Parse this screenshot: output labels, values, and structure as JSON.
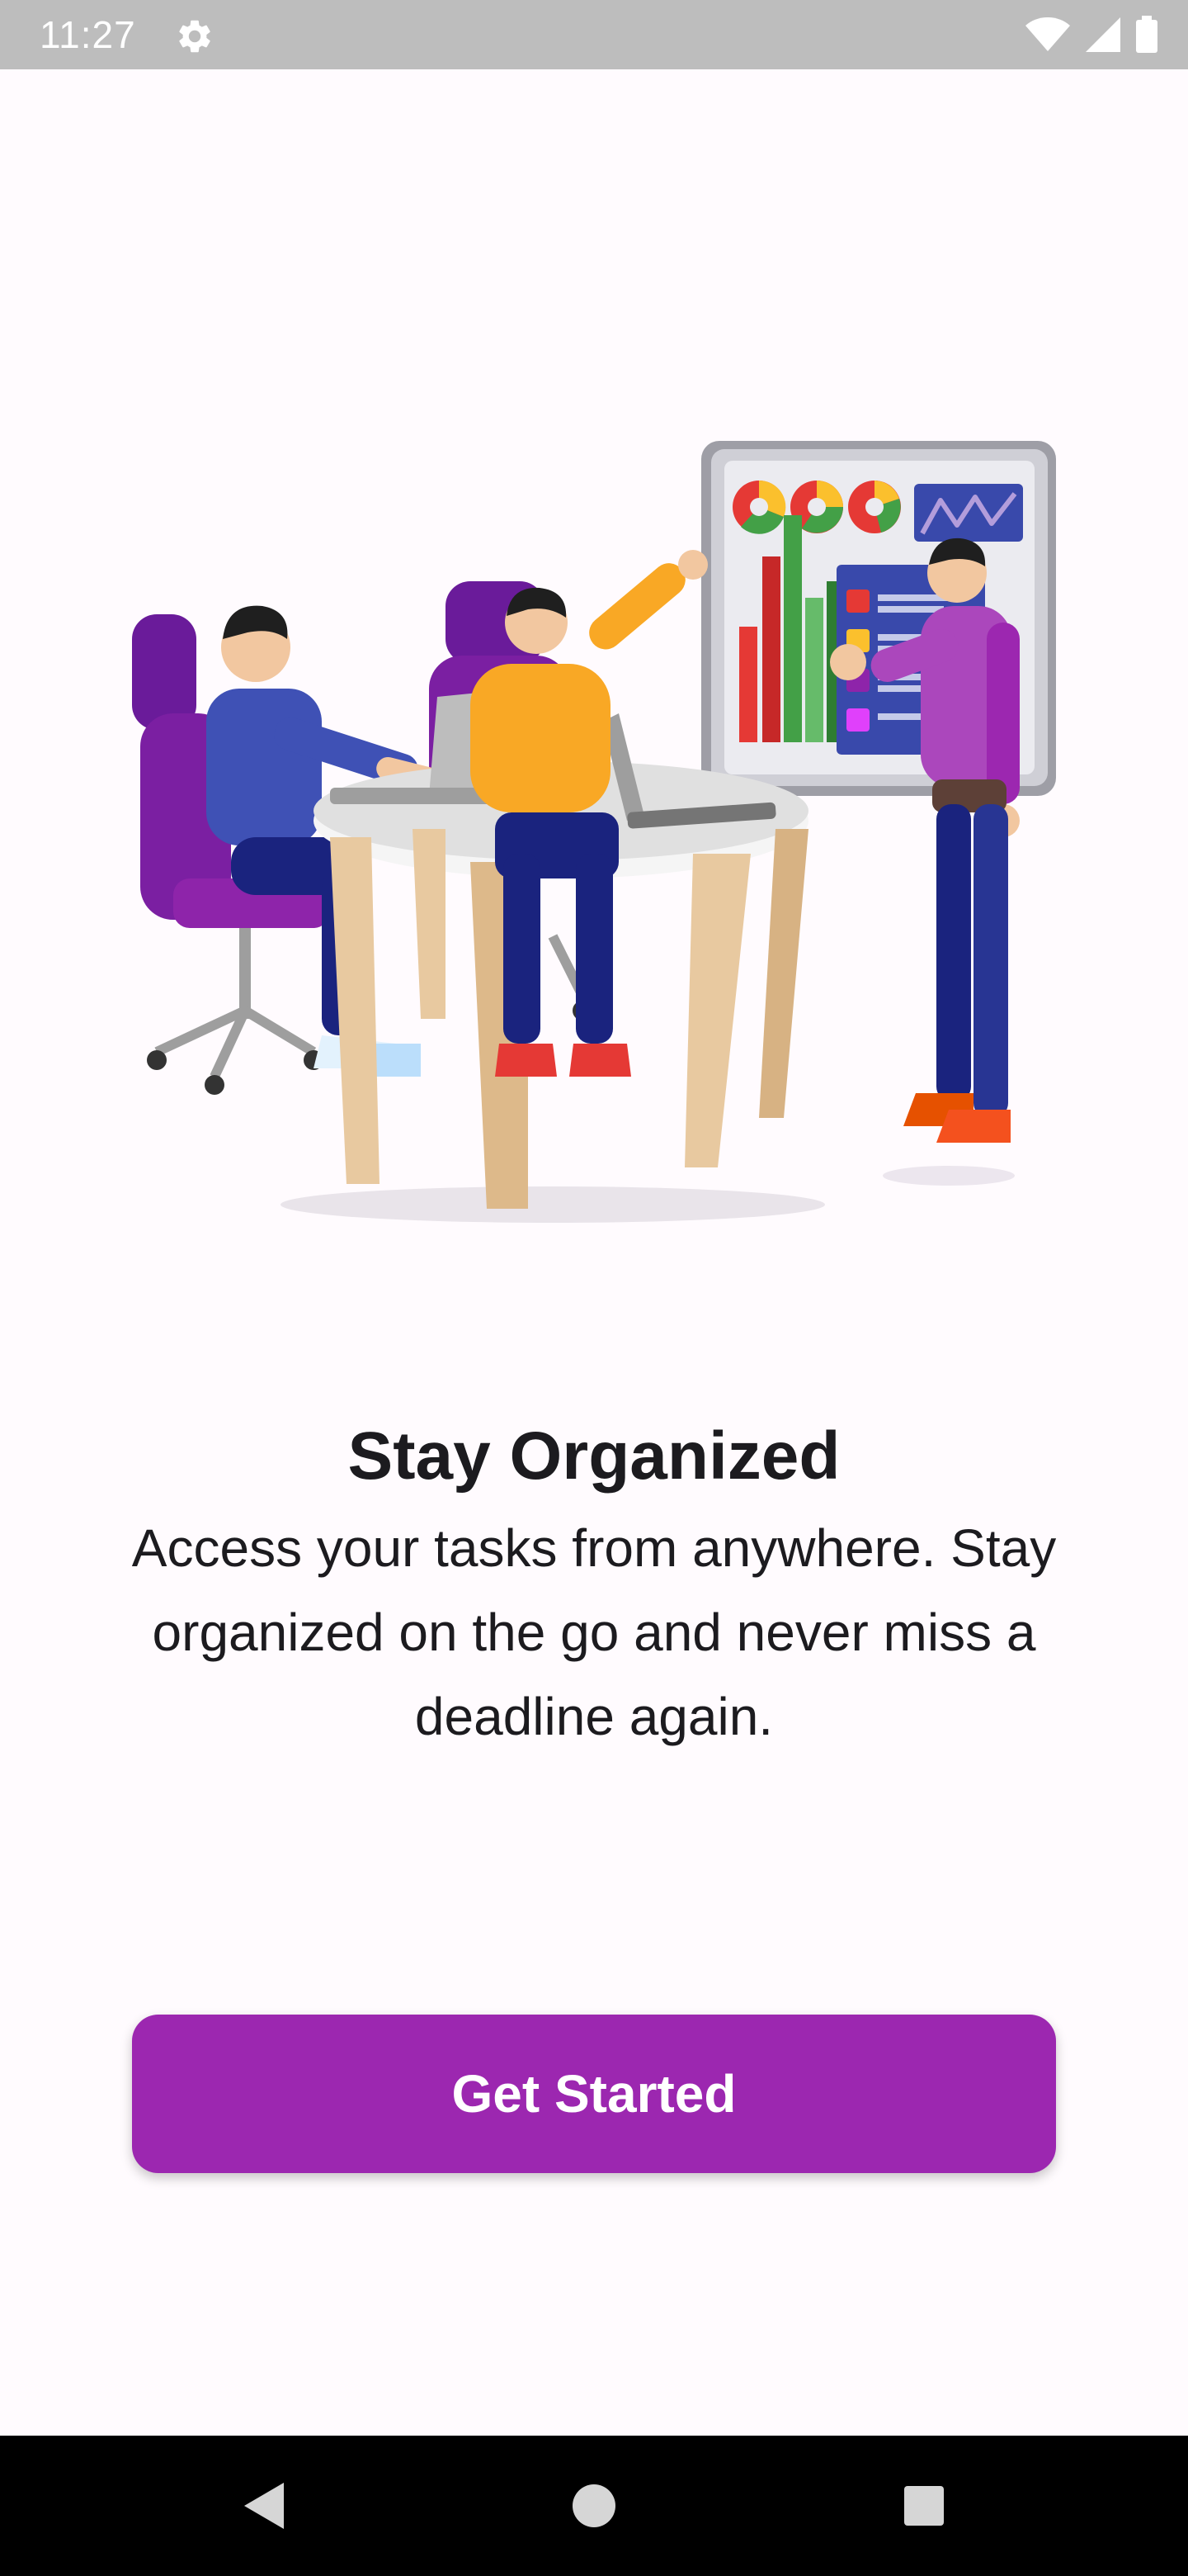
{
  "status_bar": {
    "time": "11:27",
    "icons": [
      "gear-icon",
      "wifi-icon",
      "signal-icon",
      "battery-icon"
    ]
  },
  "onboarding": {
    "illustration": "team-meeting-illustration",
    "title": "Stay Organized",
    "description": "Access your tasks from anywhere. Stay organized on the go and never miss a deadline again.",
    "button_label": "Get Started"
  },
  "nav_bar": {
    "icons": [
      "back-icon",
      "home-icon",
      "recents-icon"
    ]
  },
  "colors": {
    "accent": "#9c27b0",
    "background": "#fffbfe",
    "status_bar": "#bdbdbd",
    "text": "#1c1b1f"
  }
}
